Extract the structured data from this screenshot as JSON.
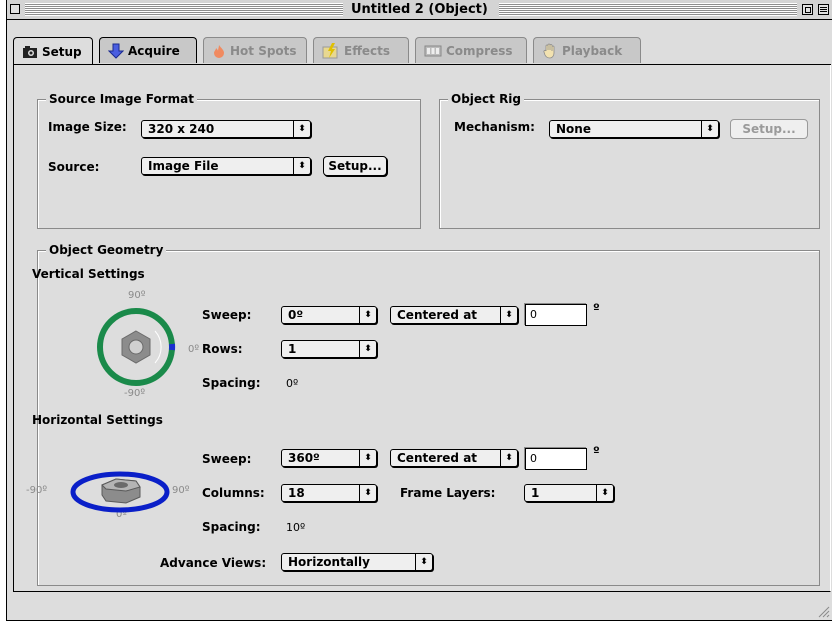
{
  "window": {
    "title": "Untitled 2 (Object)"
  },
  "tabs": [
    {
      "label": "Setup",
      "icon": "camera-icon",
      "state": "active"
    },
    {
      "label": "Acquire",
      "icon": "down-arrow-icon",
      "state": "normal"
    },
    {
      "label": "Hot Spots",
      "icon": "flame-icon",
      "state": "disabled"
    },
    {
      "label": "Effects",
      "icon": "lightning-icon",
      "state": "disabled"
    },
    {
      "label": "Compress",
      "icon": "film-icon",
      "state": "disabled"
    },
    {
      "label": "Playback",
      "icon": "hand-icon",
      "state": "disabled"
    }
  ],
  "source_image_format": {
    "title": "Source Image Format",
    "image_size_label": "Image Size:",
    "image_size_value": "320 x 240",
    "source_label": "Source:",
    "source_value": "Image File",
    "setup_button": "Setup..."
  },
  "object_rig": {
    "title": "Object Rig",
    "mechanism_label": "Mechanism:",
    "mechanism_value": "None",
    "setup_button": "Setup..."
  },
  "object_geometry": {
    "title": "Object Geometry",
    "vertical": {
      "title": "Vertical Settings",
      "diagram_top": "90º",
      "diagram_right": "0º",
      "diagram_bottom": "-90º",
      "sweep_label": "Sweep:",
      "sweep_value": "0º",
      "centered_value": "Centered at",
      "center_field": "0",
      "center_unit": "º",
      "rows_label": "Rows:",
      "rows_value": "1",
      "spacing_label": "Spacing:",
      "spacing_value": "0º"
    },
    "horizontal": {
      "title": "Horizontal Settings",
      "diagram_left": "-90º",
      "diagram_right": "90º",
      "diagram_bottom": "0º",
      "sweep_label": "Sweep:",
      "sweep_value": "360º",
      "centered_value": "Centered at",
      "center_field": "0",
      "center_unit": "º",
      "columns_label": "Columns:",
      "columns_value": "18",
      "frame_layers_label": "Frame Layers:",
      "frame_layers_value": "1",
      "spacing_label": "Spacing:",
      "spacing_value": "10º"
    },
    "advance_views_label": "Advance Views:",
    "advance_views_value": "Horizontally"
  },
  "colors": {
    "vertical_ring": "#1a8a4a",
    "vertical_arc": "#1a2fd0",
    "horizontal_ring": "#0a1fc8",
    "window_bg": "#dddddd"
  }
}
